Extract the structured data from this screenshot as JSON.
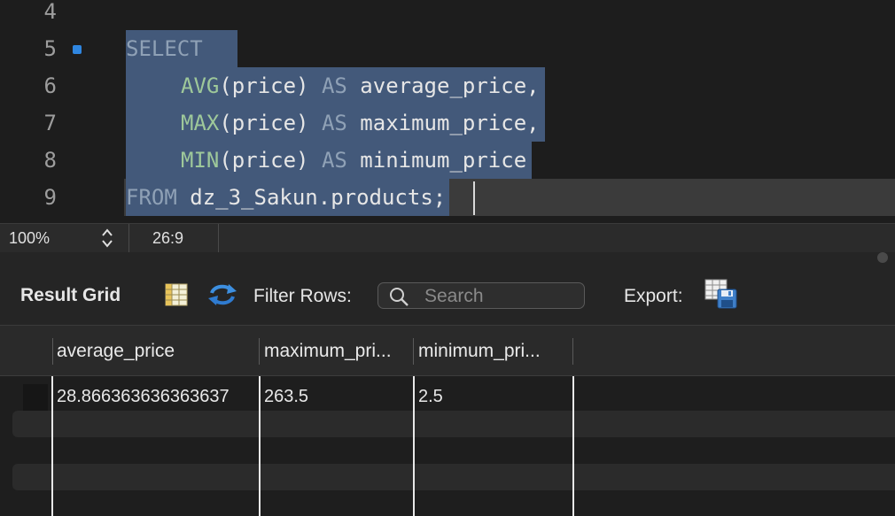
{
  "editor": {
    "lines": [
      {
        "num": "4"
      },
      {
        "num": "5"
      },
      {
        "num": "6"
      },
      {
        "num": "7"
      },
      {
        "num": "8"
      },
      {
        "num": "9"
      }
    ],
    "code": {
      "l5_kw": "SELECT",
      "l6_fn": "AVG",
      "l6_mid": "(price) ",
      "l6_kw": "AS",
      "l6_tail": " average_price,",
      "l7_fn": "MAX",
      "l7_mid": "(price) ",
      "l7_kw": "AS",
      "l7_tail": " maximum_price,",
      "l8_fn": "MIN",
      "l8_mid": "(price) ",
      "l8_kw": "AS",
      "l8_tail": " minimum_price",
      "l9_kw": "FROM",
      "l9_tail": " dz_3_Sakun.products;"
    },
    "selection_color": "#43597a",
    "marker_color": "#2f86e0"
  },
  "statusbar": {
    "zoom": "100%",
    "cursor_position": "26:9"
  },
  "toolbar": {
    "result_grid_label": "Result Grid",
    "filter_rows_label": "Filter Rows:",
    "search_placeholder": "Search",
    "export_label": "Export:"
  },
  "grid": {
    "columns": [
      "average_price",
      "maximum_pri...",
      "minimum_pri..."
    ],
    "rows": [
      [
        "28.866363636363637",
        "263.5",
        "2.5"
      ]
    ]
  },
  "icons": {
    "grid": "grid-view-icon",
    "refresh": "refresh-icon",
    "search": "search-icon",
    "export": "export-icon",
    "stepper": "chevron-updown-icon"
  }
}
